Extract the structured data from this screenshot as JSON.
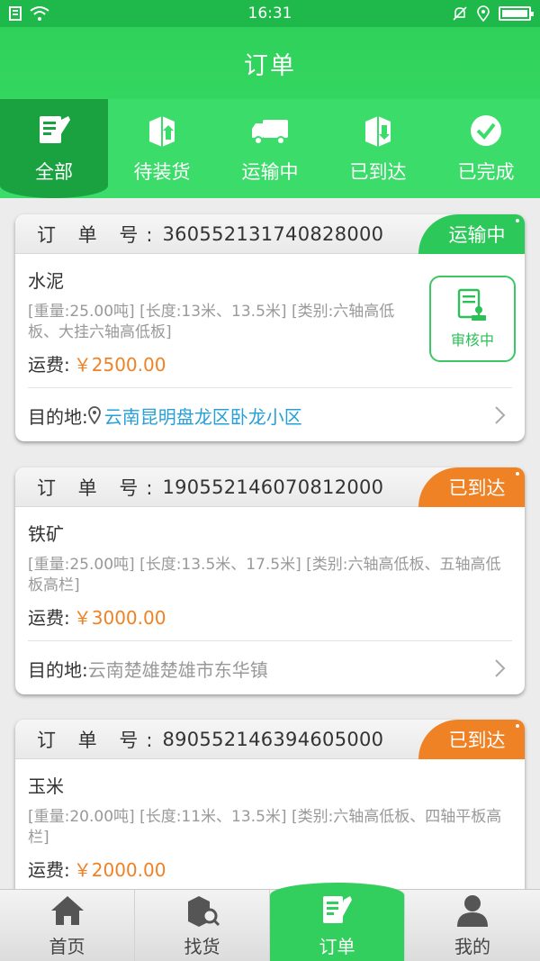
{
  "status_bar": {
    "time": "16:31"
  },
  "header": {
    "title": "订单"
  },
  "tabs": [
    {
      "label": "全部",
      "icon": "edit-doc-icon",
      "active": true
    },
    {
      "label": "待装货",
      "icon": "box-up-icon",
      "active": false
    },
    {
      "label": "运输中",
      "icon": "truck-icon",
      "active": false
    },
    {
      "label": "已到达",
      "icon": "box-down-icon",
      "active": false
    },
    {
      "label": "已完成",
      "icon": "check-circle-icon",
      "active": false
    }
  ],
  "orders": [
    {
      "order_label": "订 单 号:",
      "order_no": "360552131740828000",
      "status": "运输中",
      "status_color": "#2dc85a",
      "cargo": "水泥",
      "spec": "[重量:25.00吨] [长度:13米、13.5米] [类别:六轴高低板、大挂六轴高低板]",
      "fee_label": "运费:",
      "fee": "￥2500.00",
      "dest_label": "目的地:",
      "dest": "云南昆明盘龙区卧龙小区",
      "review_label": "审核中"
    },
    {
      "order_label": "订 单 号:",
      "order_no": "190552146070812000",
      "status": "已到达",
      "status_color": "#f08226",
      "cargo": "铁矿",
      "spec": "[重量:25.00吨] [长度:13.5米、17.5米] [类别:六轴高低板、五轴高低板高栏]",
      "fee_label": "运费:",
      "fee": "￥3000.00",
      "dest_label": "目的地:",
      "dest": "云南楚雄楚雄市东华镇"
    },
    {
      "order_label": "订 单 号:",
      "order_no": "890552146394605000",
      "status": "已到达",
      "status_color": "#f08226",
      "cargo": "玉米",
      "spec": "[重量:20.00吨] [长度:11米、13.5米] [类别:六轴高低板、四轴平板高栏]",
      "fee_label": "运费:",
      "fee": "￥2000.00"
    }
  ],
  "bottom_nav": [
    {
      "label": "首页",
      "icon": "home-icon",
      "active": false
    },
    {
      "label": "找货",
      "icon": "search-goods-icon",
      "active": false
    },
    {
      "label": "订单",
      "icon": "edit-doc-icon",
      "active": true
    },
    {
      "label": "我的",
      "icon": "user-icon",
      "active": false
    }
  ]
}
